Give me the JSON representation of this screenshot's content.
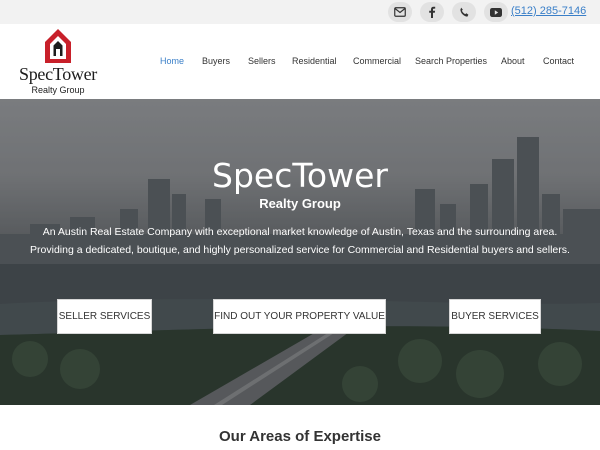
{
  "topbar": {
    "icons": [
      "envelope-icon",
      "facebook-icon",
      "phone-icon",
      "youtube-icon"
    ],
    "phone": "(512) 285-7146"
  },
  "brand": {
    "name": "SpecTower",
    "tagline": "Realty Group",
    "logo_color": "#c8202a"
  },
  "nav": {
    "items": [
      "Home",
      "Buyers",
      "Sellers",
      "Residential",
      "Commercial",
      "Search Properties",
      "About",
      "Contact"
    ],
    "active": "Home",
    "active_color": "#3a7fc8"
  },
  "hero": {
    "title": "SpecTower",
    "subtitle": "Realty Group",
    "description": "An Austin Real Estate Company with exceptional market knowledge of Austin, Texas and the surrounding area. Providing a dedicated, boutique, and highly personalized service for Commercial and Residential buyers and sellers.",
    "buttons": [
      "SELLER SERVICES",
      "FIND OUT YOUR PROPERTY VALUE",
      "BUYER SERVICES"
    ]
  },
  "section": {
    "heading": "Our Areas of Expertise"
  }
}
